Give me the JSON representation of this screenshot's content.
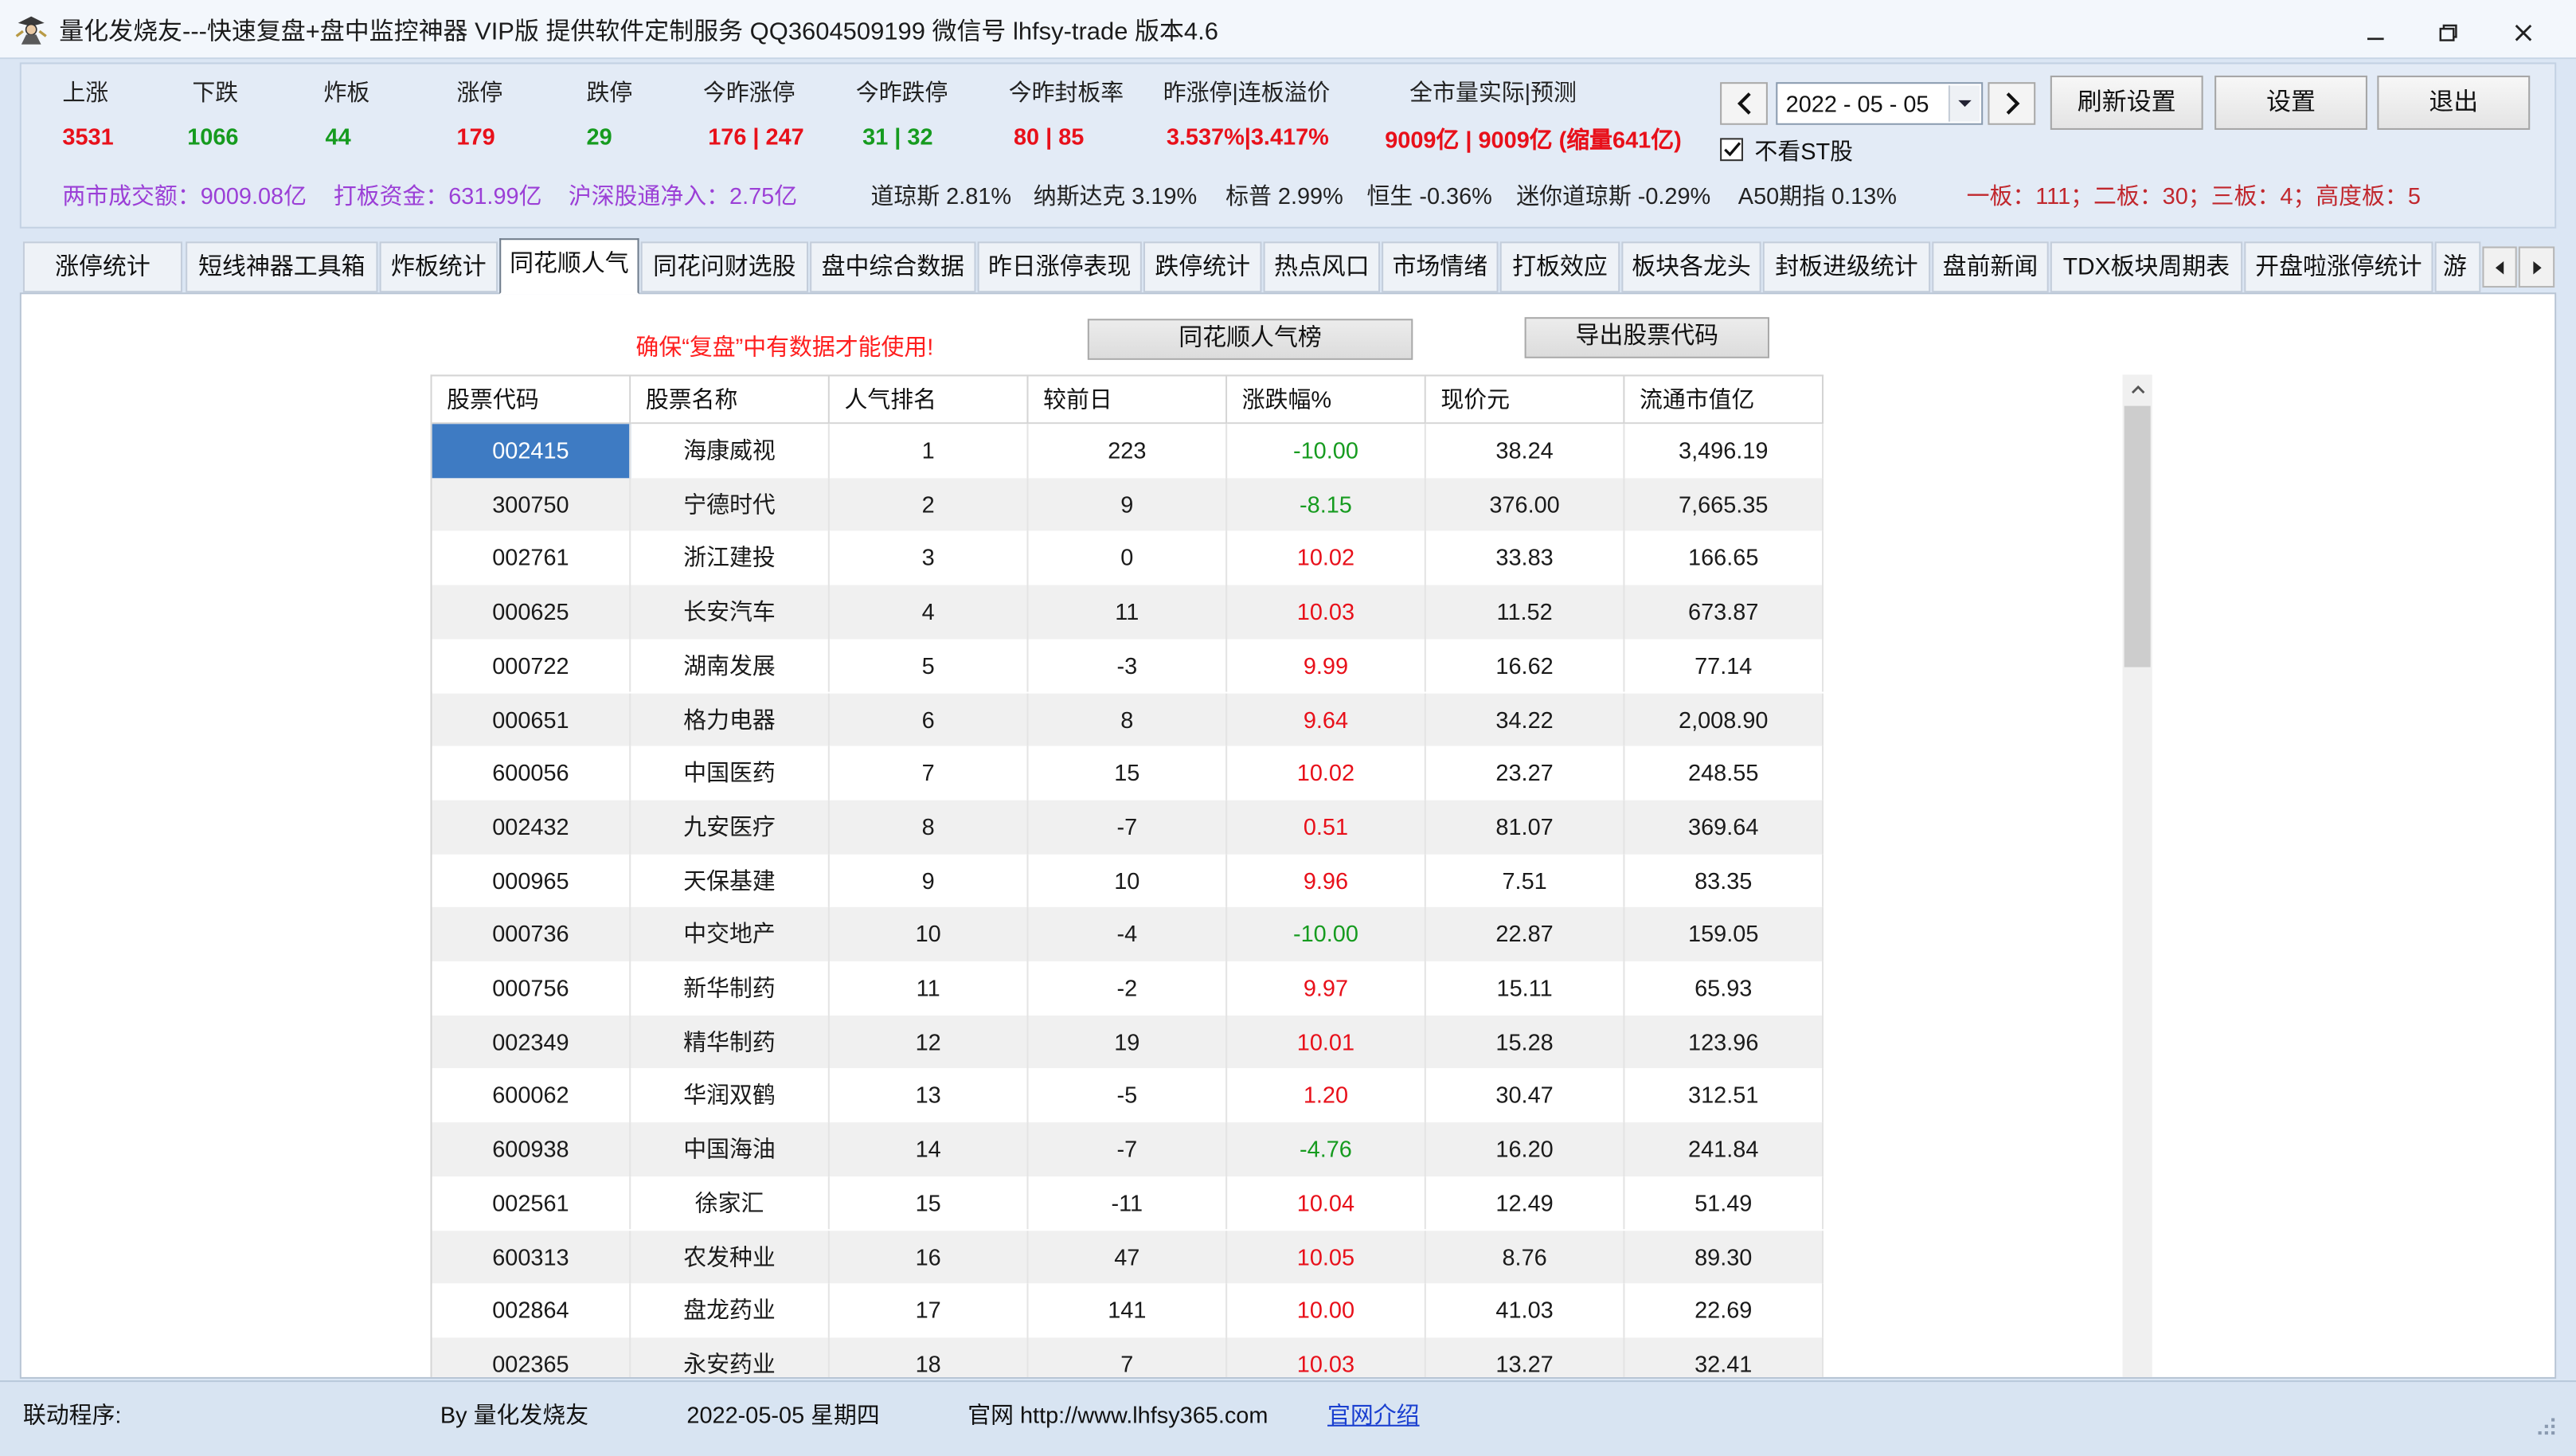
{
  "window": {
    "title": "量化发烧友---快速复盘+盘中监控神器 VIP版  提供软件定制服务 QQ3604509199 微信号 lhfsy-trade  版本4.6",
    "icon": "app-icon",
    "controls": [
      "minimize-icon",
      "maximize-icon",
      "close-icon"
    ]
  },
  "colors": {
    "up": "#e8101a",
    "down": "#169b1f",
    "summary": "#9b3fd6",
    "boards": "#c1272d",
    "selection": "#3e7bc3"
  },
  "stats": [
    {
      "label": "上涨",
      "value": "3531",
      "color": "#e8101a"
    },
    {
      "label": "下跌",
      "value": "1066",
      "color": "#169b1f"
    },
    {
      "label": "炸板",
      "value": "44",
      "color": "#169b1f"
    },
    {
      "label": "涨停",
      "value": "179",
      "color": "#e8101a"
    },
    {
      "label": "跌停",
      "value": "29",
      "color": "#169b1f"
    },
    {
      "label": "今昨涨停",
      "value": "176 | 247",
      "color": "#e8101a"
    },
    {
      "label": "今昨跌停",
      "value": "31 | 32",
      "color": "#169b1f"
    },
    {
      "label": "今昨封板率",
      "value": "80 | 85",
      "color": "#e8101a"
    },
    {
      "label": "昨涨停|连板溢价",
      "value": "3.537%|3.417%",
      "color": "#e8101a"
    },
    {
      "label": "全市量实际|预测",
      "value": "9009亿 | 9009亿 (缩量641亿)",
      "color": "#e8101a"
    }
  ],
  "date_picker": {
    "value": "2022 - 05 - 05"
  },
  "buttons": {
    "refresh_settings": "刷新设置",
    "settings": "设置",
    "exit": "退出"
  },
  "st_filter": {
    "label": "不看ST股",
    "checked": true
  },
  "market_summary": {
    "turnover": "两市成交额：9009.08亿",
    "board_funds": "打板资金：631.99亿",
    "northbound": "沪深股通净入：2.75亿"
  },
  "indices": [
    "道琼斯 2.81%",
    "纳斯达克 3.19%",
    "标普 2.99%",
    "恒生 -0.36%",
    "迷你道琼斯 -0.29%",
    "A50期指 0.13%"
  ],
  "board_counts": "一板：111；二板：30；三板：4；高度板：5",
  "tabs": [
    "涨停统计",
    "短线神器工具箱",
    "炸板统计",
    "同花顺人气",
    "同花问财选股",
    "盘中综合数据",
    "昨日涨停表现",
    "跌停统计",
    "热点风口",
    "市场情绪",
    "打板效应",
    "板块各龙头",
    "封板进级统计",
    "盘前新闻",
    "TDX板块周期表",
    "开盘啦涨停统计",
    "游"
  ],
  "active_tab": "同花顺人气",
  "content": {
    "warning": "确保“复盘”中有数据才能使用!",
    "ranking_button": "同花顺人气榜",
    "export_button": "导出股票代码"
  },
  "table": {
    "columns": [
      "股票代码",
      "股票名称",
      "人气排名",
      "较前日",
      "涨跌幅%",
      "现价元",
      "流通市值亿"
    ],
    "selected": {
      "row": 0,
      "column": "code"
    },
    "rows": [
      {
        "code": "002415",
        "name": "海康威视",
        "rank": "1",
        "change_vs_prev": "223",
        "pct_change": "-10.00",
        "price": "38.24",
        "float_cap": "3,496.19"
      },
      {
        "code": "300750",
        "name": "宁德时代",
        "rank": "2",
        "change_vs_prev": "9",
        "pct_change": "-8.15",
        "price": "376.00",
        "float_cap": "7,665.35"
      },
      {
        "code": "002761",
        "name": "浙江建投",
        "rank": "3",
        "change_vs_prev": "0",
        "pct_change": "10.02",
        "price": "33.83",
        "float_cap": "166.65"
      },
      {
        "code": "000625",
        "name": "长安汽车",
        "rank": "4",
        "change_vs_prev": "11",
        "pct_change": "10.03",
        "price": "11.52",
        "float_cap": "673.87"
      },
      {
        "code": "000722",
        "name": "湖南发展",
        "rank": "5",
        "change_vs_prev": "-3",
        "pct_change": "9.99",
        "price": "16.62",
        "float_cap": "77.14"
      },
      {
        "code": "000651",
        "name": "格力电器",
        "rank": "6",
        "change_vs_prev": "8",
        "pct_change": "9.64",
        "price": "34.22",
        "float_cap": "2,008.90"
      },
      {
        "code": "600056",
        "name": "中国医药",
        "rank": "7",
        "change_vs_prev": "15",
        "pct_change": "10.02",
        "price": "23.27",
        "float_cap": "248.55"
      },
      {
        "code": "002432",
        "name": "九安医疗",
        "rank": "8",
        "change_vs_prev": "-7",
        "pct_change": "0.51",
        "price": "81.07",
        "float_cap": "369.64"
      },
      {
        "code": "000965",
        "name": "天保基建",
        "rank": "9",
        "change_vs_prev": "10",
        "pct_change": "9.96",
        "price": "7.51",
        "float_cap": "83.35"
      },
      {
        "code": "000736",
        "name": "中交地产",
        "rank": "10",
        "change_vs_prev": "-4",
        "pct_change": "-10.00",
        "price": "22.87",
        "float_cap": "159.05"
      },
      {
        "code": "000756",
        "name": "新华制药",
        "rank": "11",
        "change_vs_prev": "-2",
        "pct_change": "9.97",
        "price": "15.11",
        "float_cap": "65.93"
      },
      {
        "code": "002349",
        "name": "精华制药",
        "rank": "12",
        "change_vs_prev": "19",
        "pct_change": "10.01",
        "price": "15.28",
        "float_cap": "123.96"
      },
      {
        "code": "600062",
        "name": "华润双鹤",
        "rank": "13",
        "change_vs_prev": "-5",
        "pct_change": "1.20",
        "price": "30.47",
        "float_cap": "312.51"
      },
      {
        "code": "600938",
        "name": "中国海油",
        "rank": "14",
        "change_vs_prev": "-7",
        "pct_change": "-4.76",
        "price": "16.20",
        "float_cap": "241.84"
      },
      {
        "code": "002561",
        "name": "徐家汇",
        "rank": "15",
        "change_vs_prev": "-11",
        "pct_change": "10.04",
        "price": "12.49",
        "float_cap": "51.49"
      },
      {
        "code": "600313",
        "name": "农发种业",
        "rank": "16",
        "change_vs_prev": "47",
        "pct_change": "10.05",
        "price": "8.76",
        "float_cap": "89.30"
      },
      {
        "code": "002864",
        "name": "盘龙药业",
        "rank": "17",
        "change_vs_prev": "141",
        "pct_change": "10.00",
        "price": "41.03",
        "float_cap": "22.69"
      },
      {
        "code": "002365",
        "name": "永安药业",
        "rank": "18",
        "change_vs_prev": "7",
        "pct_change": "10.03",
        "price": "13.27",
        "float_cap": "32.41"
      }
    ]
  },
  "status_bar": {
    "linked_program": "联动程序:",
    "author": "By 量化发烧友",
    "date": "2022-05-05 星期四",
    "website": "官网 http://www.lhfsy365.com",
    "website_intro": "官网介绍"
  }
}
